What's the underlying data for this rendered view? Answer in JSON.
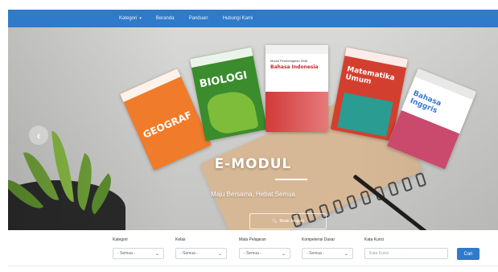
{
  "navbar": {
    "items": [
      {
        "label": "Kategori",
        "has_dropdown": true
      },
      {
        "label": "Beranda"
      },
      {
        "label": "Panduan"
      },
      {
        "label": "Hubungi Kami"
      }
    ]
  },
  "hero": {
    "books": [
      {
        "title": "GEOGRAF"
      },
      {
        "title": "BIOLOGI"
      },
      {
        "subtitle": "Modul Pembelajaran SMA",
        "title": "Bahasa Indonesia"
      },
      {
        "title": "Matematika Umum"
      },
      {
        "title": "Bahasa Inggris"
      }
    ],
    "title": "E-MODUL",
    "tagline": "Maju Bersama, Hebat Semua",
    "button_label": "Mulai Jelajahi"
  },
  "filters": {
    "kategori": {
      "label": "Kategori",
      "value": "- Semua -"
    },
    "kelas": {
      "label": "Kelas",
      "value": "- Semua -"
    },
    "mata_pelajaran": {
      "label": "Mata Pelajaran",
      "value": "- Semua -"
    },
    "kompetensi": {
      "label": "Kompetensi Dasar",
      "value": "- Semua -"
    },
    "kata_kunci": {
      "label": "Kata Kunci",
      "placeholder": "Kata Kunci"
    },
    "search_button": "Cari"
  },
  "colors": {
    "primary": "#2f7ac9"
  }
}
